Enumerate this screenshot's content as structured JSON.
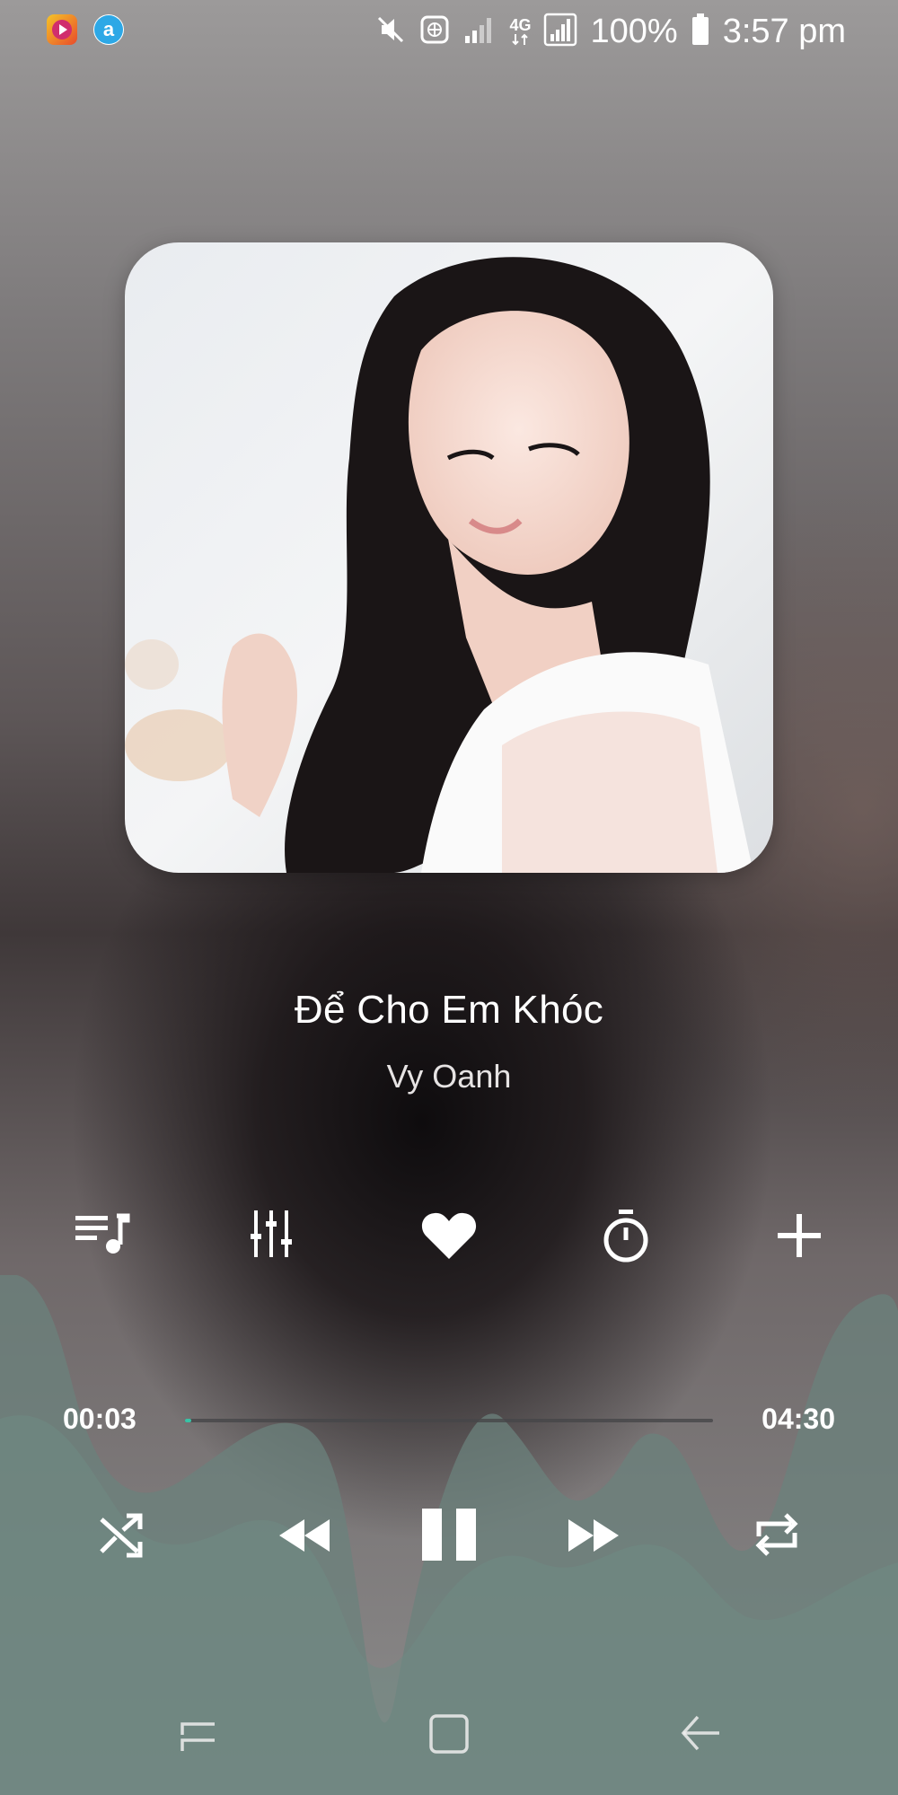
{
  "status_bar": {
    "battery": "100%",
    "time": "3:57 pm",
    "network": "4G",
    "icons": [
      "video-app-icon",
      "a-app-icon",
      "mute-icon",
      "globe-icon",
      "signal-weak-icon",
      "4g-icon",
      "signal-icon",
      "battery-icon"
    ]
  },
  "song": {
    "title": "Để Cho Em Khóc",
    "artist": "Vy Oanh"
  },
  "actions": [
    "playlist-icon",
    "equalizer-icon",
    "heart-icon",
    "timer-icon",
    "add-icon"
  ],
  "progress": {
    "current": "00:03",
    "total": "04:30",
    "fraction": 0.012
  },
  "controls": [
    "shuffle-icon",
    "rewind-icon",
    "pause-icon",
    "fast-forward-icon",
    "repeat-icon"
  ],
  "navbar": [
    "recent-apps-icon",
    "home-icon",
    "back-icon"
  ],
  "colors": {
    "accent": "#38c3a6",
    "wave": "#6e857f"
  }
}
